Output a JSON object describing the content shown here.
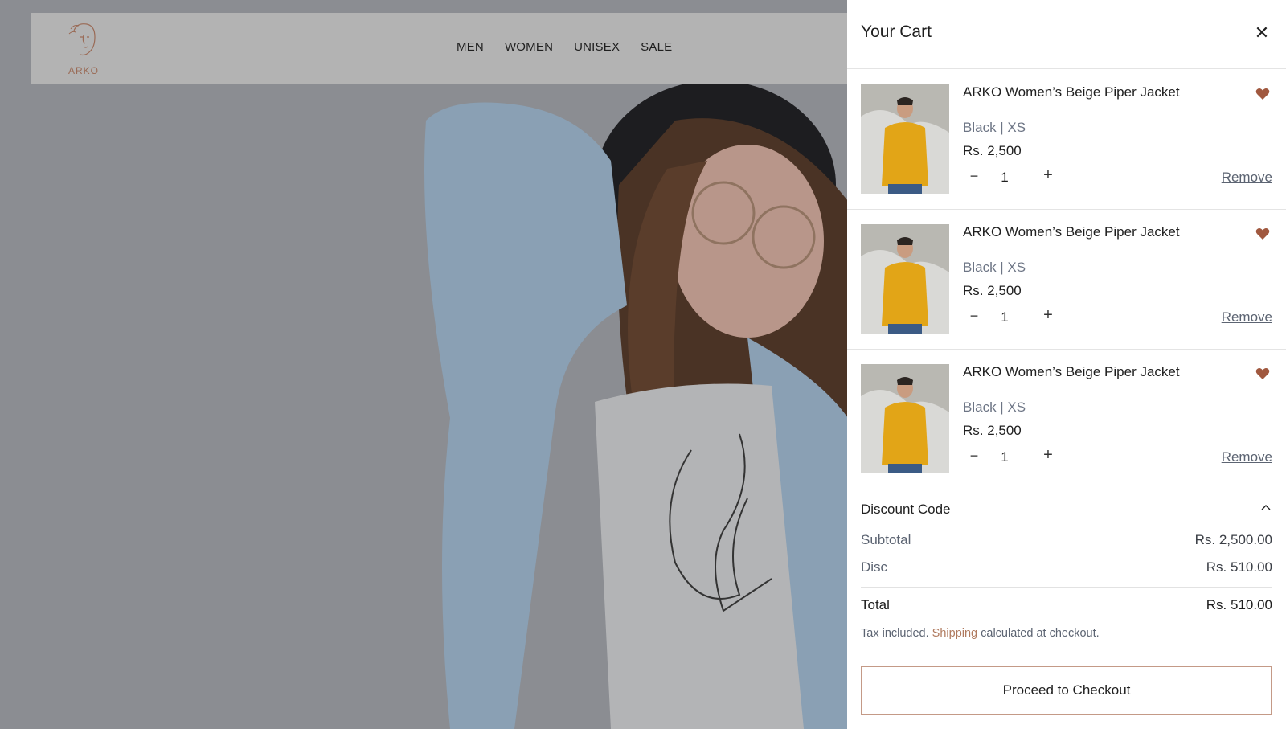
{
  "header": {
    "brand": "ARKO",
    "nav": [
      "MEN",
      "WOMEN",
      "UNISEX",
      "SALE"
    ]
  },
  "cart": {
    "title": "Your Cart",
    "close_icon": "close-icon",
    "items": [
      {
        "name": "ARKO Women’s Beige Piper Jacket",
        "variant": "Black | XS",
        "price": "Rs. 2,500",
        "qty": "1",
        "remove": "Remove"
      },
      {
        "name": "ARKO Women’s Beige Piper Jacket",
        "variant": "Black | XS",
        "price": "Rs. 2,500",
        "qty": "1",
        "remove": "Remove"
      },
      {
        "name": "ARKO Women’s Beige Piper Jacket",
        "variant": "Black | XS",
        "price": "Rs. 2,500",
        "qty": "1",
        "remove": "Remove"
      }
    ],
    "qty_minus": "−",
    "qty_plus": "+"
  },
  "summary": {
    "discount_label": "Discount Code",
    "subtotal_label": "Subtotal",
    "subtotal_value": "Rs. 2,500.00",
    "disc_label": "Disc",
    "disc_value": "Rs. 510.00",
    "total_label": "Total",
    "total_value": "Rs. 510.00",
    "tax_prefix": "Tax included.",
    "tax_link": "Shipping",
    "tax_suffix": "calculated at checkout.",
    "checkout_label": "Proceed to Checkout"
  },
  "colors": {
    "accent": "#b07a5e",
    "heart": "#a0583f",
    "overlay": "#8b8d92"
  }
}
